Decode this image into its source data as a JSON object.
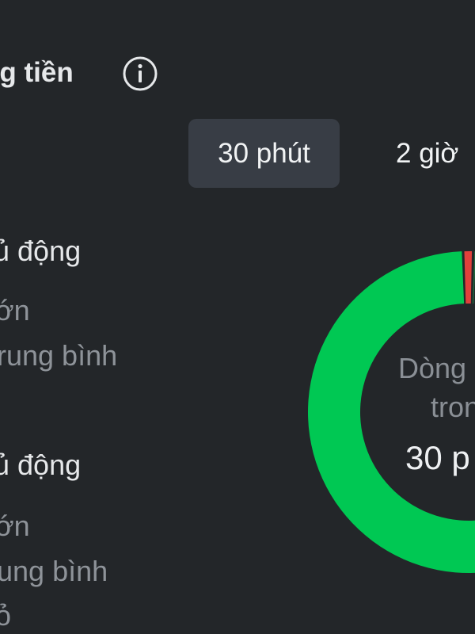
{
  "header": {
    "title_fragment": "ng tiền",
    "info_icon": "info-circle-icon"
  },
  "period_selector": {
    "selected": "30 phút",
    "other": "2 giờ"
  },
  "legend": {
    "group_1": {
      "heading": "ủ động",
      "items": [
        "ớn",
        "rung bình"
      ]
    },
    "group_2": {
      "heading": "ủ động",
      "items": [
        "ớn",
        "ung bình",
        "ỏ"
      ]
    }
  },
  "donut": {
    "center_label_line1": "Dòng",
    "center_label_line2": "tron",
    "center_value": "30 p",
    "segments": [
      {
        "fraction": 0.01,
        "color": "#e0403b"
      },
      {
        "fraction": 0.004,
        "color": "#1f6b3f"
      },
      {
        "fraction": 0.13,
        "color": "#28a05c"
      },
      {
        "fraction": 0.856,
        "color": "#00c853"
      }
    ]
  },
  "colors": {
    "background": "#232629",
    "selected_chip": "#383d45",
    "text_primary": "#e6e8ea",
    "text_secondary": "#8e9399"
  }
}
